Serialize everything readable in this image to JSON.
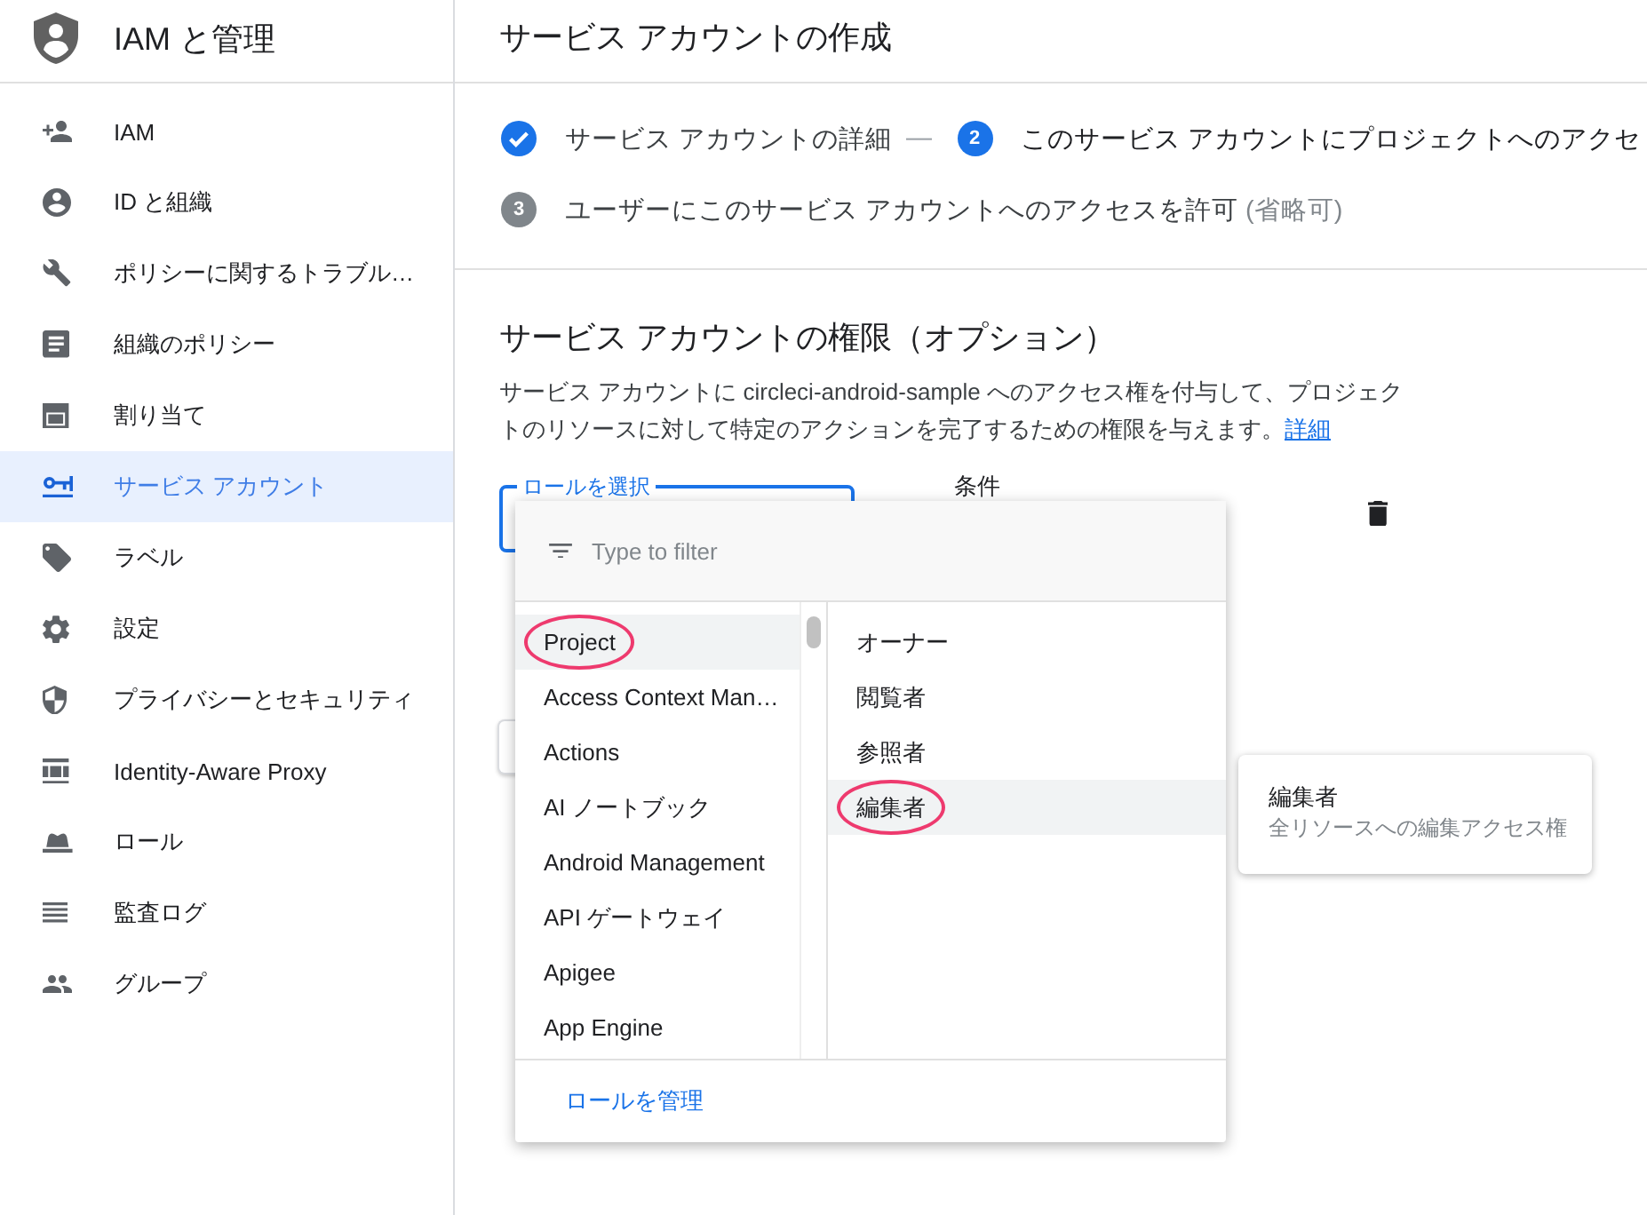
{
  "sidebar": {
    "title": "IAM と管理",
    "items": [
      {
        "label": "IAM",
        "selected": false
      },
      {
        "label": "ID と組織",
        "selected": false
      },
      {
        "label": "ポリシーに関するトラブル…",
        "selected": false
      },
      {
        "label": "組織のポリシー",
        "selected": false
      },
      {
        "label": "割り当て",
        "selected": false
      },
      {
        "label": "サービス アカウント",
        "selected": true
      },
      {
        "label": "ラベル",
        "selected": false
      },
      {
        "label": "設定",
        "selected": false
      },
      {
        "label": "プライバシーとセキュリティ",
        "selected": false
      },
      {
        "label": "Identity-Aware Proxy",
        "selected": false
      },
      {
        "label": "ロール",
        "selected": false
      },
      {
        "label": "監査ログ",
        "selected": false
      },
      {
        "label": "グループ",
        "selected": false
      }
    ]
  },
  "page": {
    "title": "サービス アカウントの作成"
  },
  "stepper": {
    "steps": [
      {
        "completed": true,
        "active": false,
        "label": "サービス アカウントの詳細",
        "separator": "—"
      },
      {
        "completed": false,
        "active": true,
        "number": "2",
        "label": "このサービス アカウントにプロジェクトへのアクセ"
      },
      {
        "completed": false,
        "active": false,
        "number": "3",
        "label": "ユーザーにこのサービス アカウントへのアクセスを許可",
        "note": "(省略可)"
      }
    ]
  },
  "permissions": {
    "title": "サービス アカウントの権限（オプション）",
    "description": "サービス アカウントに circleci-android-sample へのアクセス権を付与して、プロジェクトのリソースに対して特定のアクションを完了するための権限を与えます。",
    "link": "詳細",
    "role_field": {
      "label": "ロールを選択",
      "focused": true
    },
    "condition_label": "条件"
  },
  "role_menu": {
    "filter": {
      "placeholder": "Type to filter"
    },
    "categories": [
      {
        "label": "Project",
        "selected": true,
        "circled": true
      },
      {
        "label": "Access Context Man…",
        "selected": false,
        "circled": false
      },
      {
        "label": "Actions",
        "selected": false,
        "circled": false
      },
      {
        "label": "AI ノートブック",
        "selected": false,
        "circled": false
      },
      {
        "label": "Android Management",
        "selected": false,
        "circled": false
      },
      {
        "label": "API ゲートウェイ",
        "selected": false,
        "circled": false
      },
      {
        "label": "Apigee",
        "selected": false,
        "circled": false
      },
      {
        "label": "App Engine",
        "selected": false,
        "circled": false
      }
    ],
    "roles": [
      {
        "label": "オーナー",
        "selected": false,
        "circled": false
      },
      {
        "label": "閲覧者",
        "selected": false,
        "circled": false
      },
      {
        "label": "参照者",
        "selected": false,
        "circled": false
      },
      {
        "label": "編集者",
        "selected": true,
        "circled": true
      }
    ],
    "footer_link": "ロールを管理"
  },
  "tooltip": {
    "title": "編集者",
    "description": "全リソースへの編集アクセス権"
  }
}
